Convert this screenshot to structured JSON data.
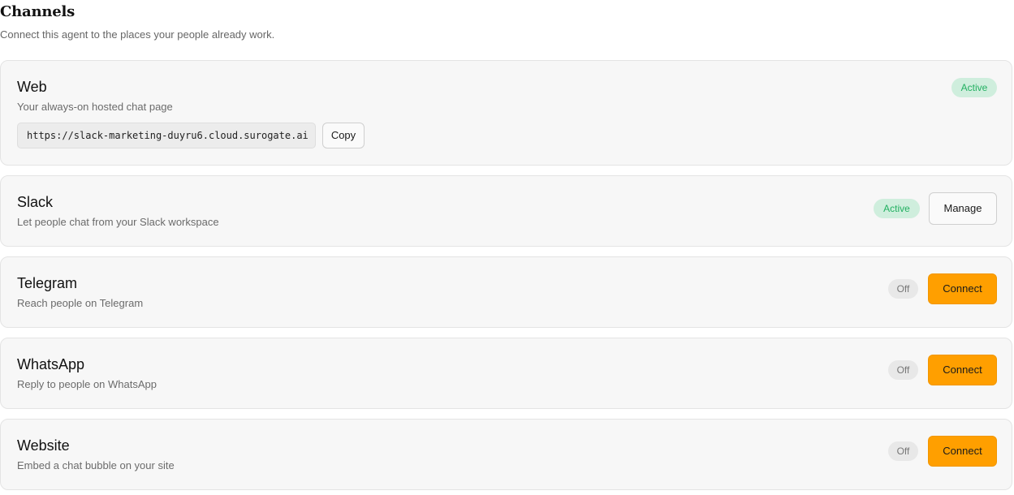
{
  "header": {
    "title": "Channels",
    "subtitle": "Connect this agent to the places your people already work."
  },
  "channels": [
    {
      "name": "Web",
      "description": "Your always-on hosted chat page",
      "status": "Active",
      "url": "https://slack-marketing-duyru6.cloud.surogate.ai",
      "copy_label": "Copy"
    },
    {
      "name": "Slack",
      "description": "Let people chat from your Slack workspace",
      "status": "Active",
      "action_label": "Manage"
    },
    {
      "name": "Telegram",
      "description": "Reach people on Telegram",
      "status": "Off",
      "action_label": "Connect"
    },
    {
      "name": "WhatsApp",
      "description": "Reply to people on WhatsApp",
      "status": "Off",
      "action_label": "Connect"
    },
    {
      "name": "Website",
      "description": "Embed a chat bubble on your site",
      "status": "Off",
      "action_label": "Connect"
    }
  ],
  "colors": {
    "accent": "#ff9f00",
    "active_badge_bg": "#cfeedd",
    "active_badge_text": "#22b061",
    "off_badge_bg": "#e8e8e8",
    "off_badge_text": "#777777"
  }
}
